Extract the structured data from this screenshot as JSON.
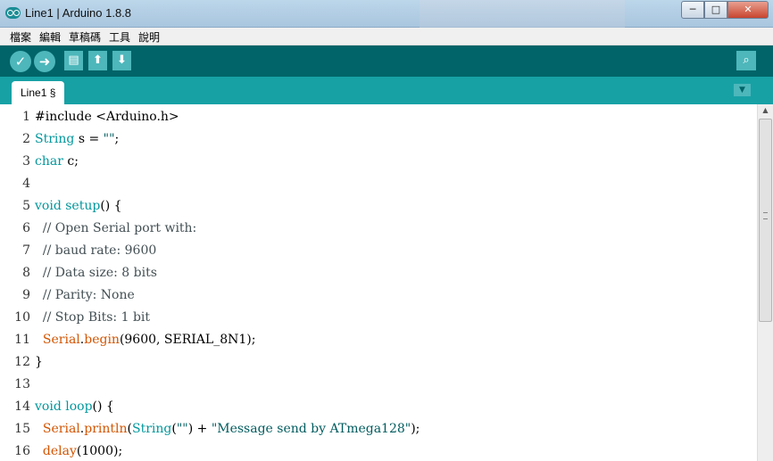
{
  "window": {
    "title": "Line1 | Arduino 1.8.8",
    "minimize_glyph": "─",
    "maximize_glyph": "□",
    "close_glyph": "✕"
  },
  "menu": {
    "items": [
      {
        "label": "檔案"
      },
      {
        "label": "編輯"
      },
      {
        "label": "草稿碼"
      },
      {
        "label": "工具"
      },
      {
        "label": "說明"
      }
    ]
  },
  "toolbar": {
    "icons": [
      "verify-icon",
      "upload-icon",
      "new-icon",
      "open-icon",
      "save-icon",
      "serial-monitor-icon"
    ],
    "verify_glyph": "✓",
    "upload_glyph": "➜",
    "new_glyph": "▤",
    "open_glyph": "⬆",
    "save_glyph": "⬇",
    "serial_glyph": "⌕"
  },
  "tabs": {
    "active_label": "Line1 §",
    "menu_glyph": "▼"
  },
  "colors": {
    "toolbar": "#006468",
    "tab_strip": "#17a1a5",
    "keyword": "#00979c",
    "function": "#d35400"
  },
  "editor": {
    "lines": [
      {
        "num": "1",
        "tokens": [
          [
            "pl",
            "#include <Arduino.h>"
          ]
        ]
      },
      {
        "num": "2",
        "tokens": [
          [
            "kw",
            "String"
          ],
          [
            "pl",
            " s = "
          ],
          [
            "str",
            "\"\""
          ],
          [
            "pl",
            ";"
          ]
        ]
      },
      {
        "num": "3",
        "tokens": [
          [
            "kw",
            "char"
          ],
          [
            "pl",
            " c;"
          ]
        ]
      },
      {
        "num": "4",
        "tokens": []
      },
      {
        "num": "5",
        "tokens": [
          [
            "kw",
            "void"
          ],
          [
            "pl",
            " "
          ],
          [
            "kw",
            "setup"
          ],
          [
            "pl",
            "() {"
          ]
        ]
      },
      {
        "num": "6",
        "tokens": [
          [
            "cm",
            "  // Open Serial port with:"
          ]
        ]
      },
      {
        "num": "7",
        "tokens": [
          [
            "cm",
            "  // baud rate: 9600"
          ]
        ]
      },
      {
        "num": "8",
        "tokens": [
          [
            "cm",
            "  // Data size: 8 bits"
          ]
        ]
      },
      {
        "num": "9",
        "tokens": [
          [
            "cm",
            "  // Parity: None"
          ]
        ]
      },
      {
        "num": "10",
        "tokens": [
          [
            "cm",
            "  // Stop Bits: 1 bit"
          ]
        ]
      },
      {
        "num": "11",
        "tokens": [
          [
            "pl",
            "  "
          ],
          [
            "fn",
            "Serial"
          ],
          [
            "pl",
            "."
          ],
          [
            "fn",
            "begin"
          ],
          [
            "pl",
            "(9600, SERIAL_8N1);"
          ]
        ]
      },
      {
        "num": "12",
        "tokens": [
          [
            "pl",
            "}"
          ]
        ]
      },
      {
        "num": "13",
        "tokens": []
      },
      {
        "num": "14",
        "tokens": [
          [
            "kw",
            "void"
          ],
          [
            "pl",
            " "
          ],
          [
            "kw",
            "loop"
          ],
          [
            "pl",
            "() {"
          ]
        ]
      },
      {
        "num": "15",
        "tokens": [
          [
            "pl",
            "  "
          ],
          [
            "fn",
            "Serial"
          ],
          [
            "pl",
            "."
          ],
          [
            "fn",
            "println"
          ],
          [
            "pl",
            "("
          ],
          [
            "kw",
            "String"
          ],
          [
            "pl",
            "("
          ],
          [
            "str",
            "\"\""
          ],
          [
            "pl",
            ") + "
          ],
          [
            "str",
            "\"Message send by ATmega128\""
          ],
          [
            "pl",
            ");"
          ]
        ]
      },
      {
        "num": "16",
        "tokens": [
          [
            "pl",
            "  "
          ],
          [
            "fn",
            "delay"
          ],
          [
            "pl",
            "(1000);"
          ]
        ]
      }
    ]
  }
}
